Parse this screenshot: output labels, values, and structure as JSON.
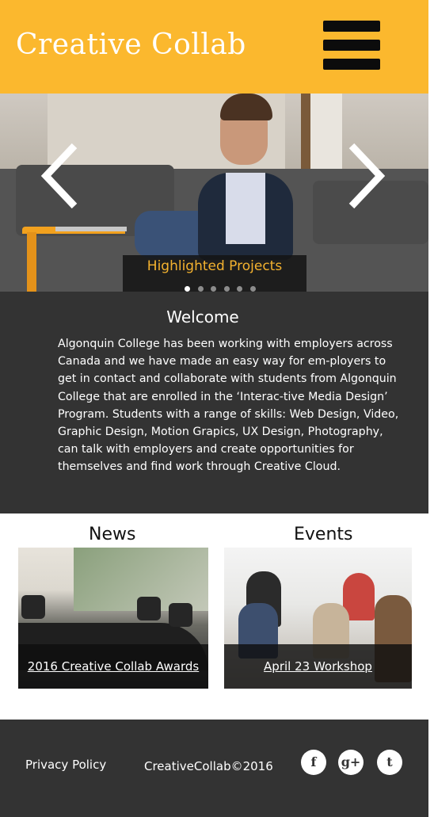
{
  "header": {
    "brand": "Creative Collab",
    "menu_icon": "hamburger-menu-icon"
  },
  "hero": {
    "caption": "Highlighted Projects",
    "slides_count": 6,
    "active_slide": 1,
    "prev_icon": "chevron-left-icon",
    "next_icon": "chevron-right-icon"
  },
  "welcome": {
    "title": "Welcome",
    "body": "Algonquin College has been working with employers across Canada and we have made an easy way for em-ployers to get in contact and collaborate with students from Algonquin College that are enrolled in the ‘Interac-tive Media Design’ Program. Students with a range of skills: Web Design, Video, Graphic Design, Motion Grapics, UX Design, Photography, can talk with employers and create opportunities for themselves and find work through Creative Cloud."
  },
  "news": {
    "title": "News",
    "link": "2016 Creative Collab Awards"
  },
  "events": {
    "title": "Events",
    "link": "April 23 Workshop"
  },
  "footer": {
    "privacy": "Privacy Policy",
    "copyright": "CreativeCollab©2016",
    "social": [
      {
        "icon": "facebook-icon",
        "glyph": "f"
      },
      {
        "icon": "google-plus-icon",
        "glyph": "g+"
      },
      {
        "icon": "twitter-icon",
        "glyph": "t"
      }
    ]
  },
  "colors": {
    "accent": "#fbb82e",
    "dark": "#333333",
    "caption_text": "#f4b22f"
  }
}
